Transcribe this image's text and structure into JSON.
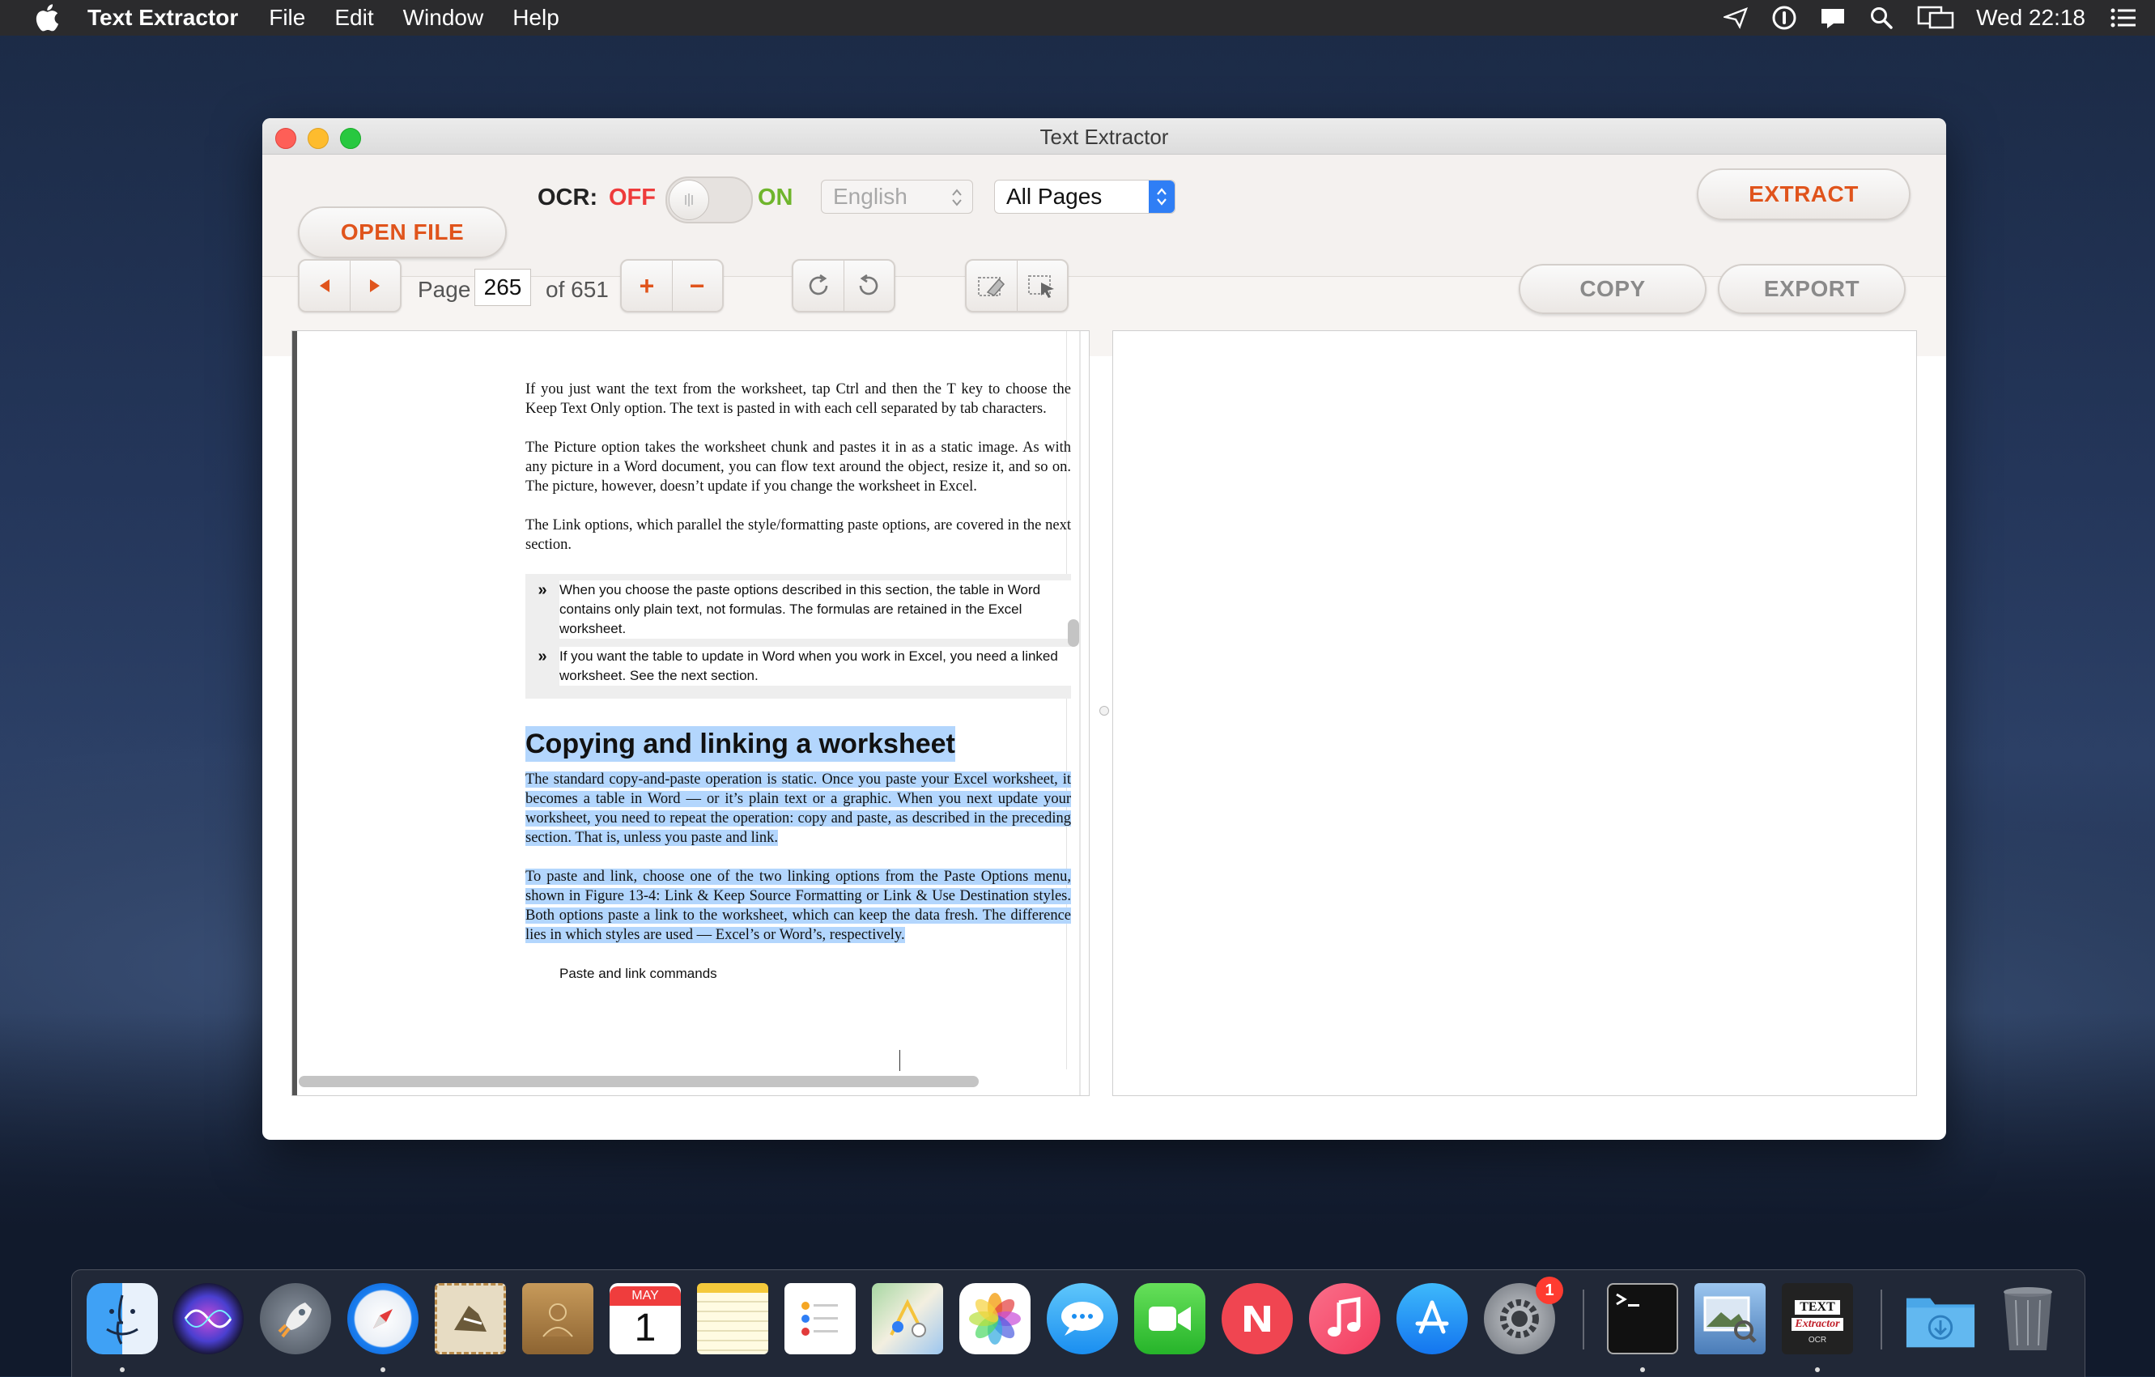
{
  "menubar": {
    "app_name": "Text Extractor",
    "items": [
      "File",
      "Edit",
      "Window",
      "Help"
    ],
    "clock": "Wed 22:18"
  },
  "window": {
    "title": "Text Extractor"
  },
  "toolbar": {
    "open_file_label": "OPEN FILE",
    "ocr_label": "OCR:",
    "ocr_off_label": "OFF",
    "ocr_on_label": "ON",
    "ocr_enabled": false,
    "language_value": "English",
    "pages_value": "All Pages",
    "extract_label": "EXTRACT"
  },
  "navigation": {
    "page_label": "Page",
    "page_current": "265",
    "page_total_label": "of 651",
    "zoom_in_label": "+",
    "zoom_out_label": "−",
    "copy_label": "COPY",
    "export_label": "EXPORT"
  },
  "document": {
    "paragraphs": [
      "If you just want the text from the worksheet, tap Ctrl and then the T key to choose the Keep Text Only option. The text is pasted in with each cell separated by tab characters.",
      "The Picture option takes the worksheet chunk and pastes it in as a static image. As with any picture in a Word document, you can flow text around the object, resize it, and so on. The picture, however, doesn’t update if you change the worksheet in Excel.",
      "The Link options, which parallel the style/formatting paste options, are covered in the next section."
    ],
    "tips": [
      "When you choose the paste options described in this section, the table in Word contains only plain text, not formulas. The formulas are retained in the Excel worksheet.",
      "If you want the table to update in Word when you work in Excel, you need a linked worksheet. See the next section."
    ],
    "heading": "Copying and linking a worksheet",
    "highlighted_paragraphs": [
      "The standard copy-and-paste operation is static. Once you paste your Excel worksheet, it becomes a table in Word — or it’s plain text or a graphic. When you next update your worksheet, you need to repeat the operation: copy and paste, as described in the preceding section. That is, unless you paste and link.",
      "To paste and link, choose one of the two linking options from the Paste Options menu, shown in Figure 13-4: Link & Keep Source Formatting or Link & Use Destination styles. Both options paste a link to the worksheet, which can keep the data fresh. The difference lies in which styles are used — Excel’s or Word’s, respectively."
    ],
    "caption": "Paste and link commands"
  },
  "dock": {
    "calendar_month": "MAY",
    "calendar_day": "1",
    "settings_badge": "1",
    "text_extractor_label_top": "TEXT",
    "text_extractor_label_bottom": "Extractor",
    "text_extractor_caption": "OCR"
  },
  "colors": {
    "accent": "#e0541c",
    "ocr_off": "#ee3b3b",
    "ocr_on": "#6fb52c",
    "selection": "#b3d6fd",
    "select_blue": "#2f7ef5"
  }
}
